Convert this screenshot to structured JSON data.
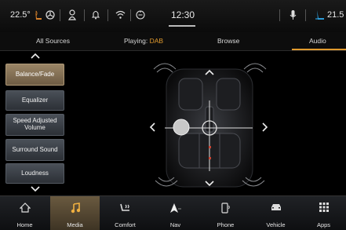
{
  "status_bar": {
    "outside_temp": "22.5°",
    "clock": "12:30",
    "cabin_temp": "21.5"
  },
  "tabs": [
    {
      "label": "All Sources"
    },
    {
      "label": "Playing: ",
      "value": "DAB"
    },
    {
      "label": "Browse"
    },
    {
      "label": "Audio"
    }
  ],
  "active_tab": "Audio",
  "audio_menu": {
    "items": [
      {
        "label": "Balance/Fade",
        "active": true
      },
      {
        "label": "Equalizer"
      },
      {
        "label": "Speed Adjusted Volume"
      },
      {
        "label": "Surround Sound"
      },
      {
        "label": "Loudness"
      }
    ]
  },
  "bottom_nav": [
    {
      "label": "Home",
      "icon": "home-icon"
    },
    {
      "label": "Media",
      "icon": "music-note-icon",
      "active": true
    },
    {
      "label": "Comfort",
      "icon": "seat-comfort-icon"
    },
    {
      "label": "Nav",
      "icon": "navigation-arrow-icon"
    },
    {
      "label": "Phone",
      "icon": "phone-icon"
    },
    {
      "label": "Vehicle",
      "icon": "car-icon"
    },
    {
      "label": "Apps",
      "icon": "apps-grid-icon"
    }
  ],
  "colors": {
    "accent": "#e09a2e",
    "active_item": "#8a7556"
  }
}
